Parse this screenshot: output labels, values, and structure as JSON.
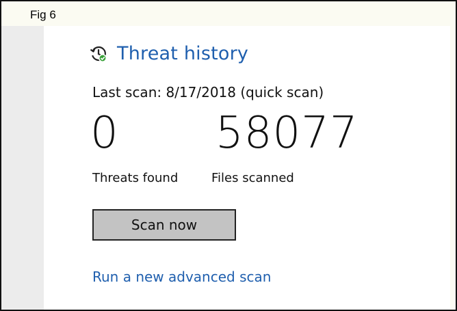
{
  "figure": {
    "label": "Fig 6"
  },
  "panel": {
    "title": "Threat history",
    "title_icon": "history-clock-icon",
    "last_scan": "Last scan: 8/17/2018 (quick scan)",
    "stats": {
      "threats_found": {
        "value": "0",
        "label": "Threats found"
      },
      "files_scanned": {
        "value": "58077",
        "label": "Files scanned"
      }
    },
    "scan_button_label": "Scan now",
    "advanced_scan_link": "Run a new advanced scan"
  },
  "colors": {
    "accent_blue": "#1f5fae",
    "button_gray": "#c3c3c3",
    "frame_background": "#fbfbf2",
    "icon_green": "#3aa13a"
  }
}
